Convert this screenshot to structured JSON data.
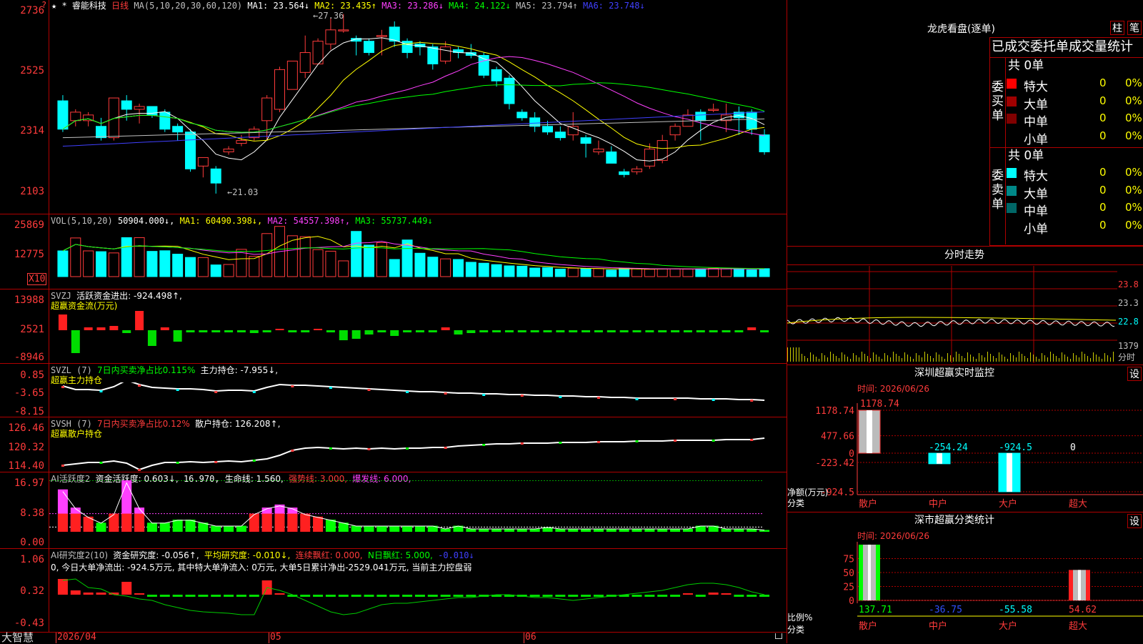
{
  "left_header": {
    "marks": "★ *",
    "stock_name": "睿能科技",
    "period": "日线",
    "ma_label": "MA(5,10,20,30,60,120)",
    "ma_items": [
      {
        "label": "MA1: 23.564↓",
        "color": "#ffffff"
      },
      {
        "label": "MA2: 23.435↑",
        "color": "#ffff00"
      },
      {
        "label": "MA3: 23.286↓",
        "color": "#ff40ff"
      },
      {
        "label": "MA4: 24.122↓",
        "color": "#00ff00"
      },
      {
        "label": "MA5: 23.794↑",
        "color": "#c0c0c0"
      },
      {
        "label": "MA6: 23.748↓",
        "color": "#4040ff"
      }
    ]
  },
  "price_panel": {
    "y_labels": [
      "2736",
      "2525",
      "2314",
      "2103"
    ],
    "high_marker": "27.36",
    "low_marker": "21.03"
  },
  "vol_panel": {
    "header": "VOL(5,10,20)",
    "vol_value": "50904.000↓,",
    "ma1": "MA1: 60490.398↓,",
    "ma2": "MA2: 54557.398↑,",
    "ma3": "MA3: 55737.449↓",
    "y_labels": [
      "25869",
      "12775"
    ],
    "unit_badge": "X10"
  },
  "svzj_panel": {
    "line1_a": "SVZJ",
    "line1_b": "活跃资金进出: -924.498↑,",
    "line2": "超赢资金流(万元)",
    "y_labels": [
      "13988",
      "2521",
      "-8946"
    ]
  },
  "svzl_panel": {
    "a": "SVZL (7)",
    "b": "7日内买卖净占比0.115%",
    "c": "主力持仓: -7.955↓,",
    "line2": "超赢主力持仓",
    "y_labels": [
      "0.85",
      "-3.65",
      "-8.15"
    ]
  },
  "svsh_panel": {
    "a": "SVSH (7)",
    "b": "7日内买卖净占比0.12%",
    "c": "散户持仓: 126.208↑,",
    "line2": "超赢散户持仓",
    "y_labels": [
      "126.46",
      "120.32",
      "114.40"
    ]
  },
  "ai_active_panel": {
    "a": "AI活跃度2",
    "b": "资金活跃度: 0.603↓,",
    "c": "16.970,",
    "d": "生命线: 1.560,",
    "e": "强势线: 3.000,",
    "f": "爆发线: 6.000,",
    "y_labels": [
      "16.97",
      "8.38",
      "0.00"
    ]
  },
  "ai_research_panel": {
    "a": "AI研究度2(10)",
    "b": "资金研究度: -0.056↑,",
    "c": "平均研究度: -0.010↓,",
    "d": "连续飘红: 0.000,",
    "e": "N日飘红: 5.000,",
    "f": "-0.010↓",
    "desc": "0, 今日大单净流出: -924.5万元, 其中特大单净流入: 0万元, 大单5日累计净出-2529.041万元, 当前主力控盘弱",
    "y_labels": [
      "1.06",
      "0.32",
      "-0.43"
    ]
  },
  "bottom_axis": {
    "brand": "大智慧",
    "dates": [
      "2026/04",
      "05",
      "06"
    ]
  },
  "dragon_tiger": {
    "title": "龙虎看盘(逐单)",
    "btn_a": "柱",
    "btn_b": "笔",
    "subtitle": "已成交委托单成交量统计",
    "buy_label": "委买单",
    "sell_label": "委卖单",
    "buy_total": "共 0单",
    "sell_total": "共 0单",
    "buy_rows": [
      {
        "name": "特大",
        "count": "0",
        "pct": "0%",
        "color": "#ff0000"
      },
      {
        "name": "大单",
        "count": "0",
        "pct": "0%",
        "color": "#a00000"
      },
      {
        "name": "中单",
        "count": "0",
        "pct": "0%",
        "color": "#800000"
      },
      {
        "name": "小单",
        "count": "0",
        "pct": "0%",
        "color": "#000000"
      }
    ],
    "sell_rows": [
      {
        "name": "特大",
        "count": "0",
        "pct": "0%",
        "color": "#00ffff"
      },
      {
        "name": "大单",
        "count": "0",
        "pct": "0%",
        "color": "#008888"
      },
      {
        "name": "中单",
        "count": "0",
        "pct": "0%",
        "color": "#006666"
      },
      {
        "name": "小单",
        "count": "0",
        "pct": "0%",
        "color": "#000000"
      }
    ]
  },
  "intraday": {
    "title": "分时走势",
    "y_labels": [
      "23.8",
      "23.3",
      "22.8"
    ],
    "vol_label": "1379",
    "vol_unit": "分时"
  },
  "sz_monitor": {
    "title": "深圳超赢实时监控",
    "settings": "设",
    "time": "时间: 2026/06/26",
    "y_labels": [
      "1178.74",
      "477.66",
      "0",
      "-223.42",
      "-924.5"
    ],
    "y_title": "净额(万元)",
    "x_title": "分类",
    "bar_values": [
      "1178.74",
      "-254.24",
      "-924.5",
      "0"
    ],
    "categories": [
      "散户",
      "中户",
      "大户",
      "超大"
    ]
  },
  "sz_class": {
    "title": "深市超赢分类统计",
    "settings": "设",
    "time": "时间: 2026/06/26",
    "y_labels": [
      "75",
      "50",
      "25",
      "0"
    ],
    "y_title": "比例%",
    "x_title": "分类",
    "bar_values": [
      "137.71",
      "-36.75",
      "-55.58",
      "54.62"
    ],
    "categories": [
      "散户",
      "中户",
      "大户",
      "超大"
    ]
  },
  "chart_data": [
    {
      "type": "candlestick",
      "title": "睿能科技 日线",
      "ylim": [
        21.03,
        27.36
      ],
      "x": [
        "2026/04",
        "05",
        "06"
      ],
      "series": [
        {
          "name": "MA1",
          "values": [
            23.564
          ]
        },
        {
          "name": "MA2",
          "values": [
            23.435
          ]
        },
        {
          "name": "MA3",
          "values": [
            23.286
          ]
        },
        {
          "name": "MA4",
          "values": [
            24.122
          ]
        },
        {
          "name": "MA5",
          "values": [
            23.794
          ]
        },
        {
          "name": "MA6",
          "values": [
            23.748
          ]
        }
      ],
      "candles": [
        [
          24.3,
          24.5,
          23.2,
          23.3
        ],
        [
          23.6,
          24.0,
          23.4,
          23.9
        ],
        [
          23.6,
          23.9,
          23.4,
          23.8
        ],
        [
          23.4,
          23.7,
          22.9,
          23.0
        ],
        [
          23.0,
          24.4,
          22.9,
          24.4
        ],
        [
          24.3,
          24.5,
          23.6,
          24.0
        ],
        [
          24.0,
          24.2,
          23.5,
          24.1
        ],
        [
          24.1,
          24.1,
          23.7,
          23.8
        ],
        [
          23.9,
          24.0,
          23.2,
          23.3
        ],
        [
          23.4,
          23.5,
          22.9,
          23.2
        ],
        [
          23.2,
          23.3,
          21.8,
          21.9
        ],
        [
          22.0,
          22.3,
          21.6,
          22.3
        ],
        [
          21.9,
          22.0,
          21.03,
          21.4
        ],
        [
          22.5,
          22.7,
          22.4,
          22.6
        ],
        [
          22.8,
          23.1,
          22.7,
          22.9
        ],
        [
          23.0,
          23.4,
          22.9,
          23.3
        ],
        [
          23.6,
          24.5,
          22.9,
          24.4
        ],
        [
          24.0,
          25.5,
          23.9,
          25.4
        ],
        [
          24.7,
          25.7,
          24.7,
          25.7
        ],
        [
          25.3,
          26.6,
          25.1,
          26.0
        ],
        [
          25.6,
          26.5,
          25.6,
          26.4
        ],
        [
          26.3,
          27.2,
          26.1,
          26.8
        ],
        [
          26.8,
          27.36,
          26.7,
          26.8
        ],
        [
          26.5,
          26.6,
          25.9,
          26.4
        ],
        [
          26.4,
          26.5,
          25.9,
          26.0
        ],
        [
          26.6,
          26.8,
          25.9,
          26.6
        ],
        [
          26.9,
          27.1,
          26.2,
          26.4
        ],
        [
          26.4,
          26.5,
          25.8,
          26.0
        ],
        [
          26.3,
          26.4,
          25.9,
          26.2
        ],
        [
          26.2,
          26.3,
          25.4,
          25.6
        ],
        [
          25.7,
          26.4,
          25.6,
          26.2
        ],
        [
          26.1,
          26.2,
          25.8,
          26.0
        ],
        [
          26.0,
          26.3,
          25.8,
          25.9
        ],
        [
          25.9,
          26.0,
          25.1,
          25.2
        ],
        [
          25.4,
          25.5,
          24.8,
          25.0
        ],
        [
          25.1,
          25.2,
          24.0,
          24.2
        ],
        [
          23.9,
          24.0,
          23.6,
          23.7
        ],
        [
          23.7,
          23.9,
          23.2,
          23.4
        ],
        [
          23.4,
          23.6,
          23.1,
          23.2
        ],
        [
          23.2,
          23.4,
          22.9,
          23.0
        ],
        [
          23.1,
          23.9,
          22.9,
          23.4
        ],
        [
          23.0,
          23.1,
          22.3,
          22.8
        ],
        [
          22.5,
          22.9,
          22.4,
          22.6
        ],
        [
          22.5,
          22.7,
          22.1,
          22.1
        ],
        [
          21.8,
          21.9,
          21.6,
          21.7
        ],
        [
          21.8,
          22.0,
          21.7,
          21.9
        ],
        [
          22.0,
          22.8,
          21.9,
          22.6
        ],
        [
          22.2,
          23.1,
          22.1,
          22.9
        ],
        [
          23.1,
          23.5,
          22.9,
          23.4
        ],
        [
          23.4,
          24.0,
          23.4,
          23.8
        ],
        [
          23.9,
          24.0,
          22.9,
          23.6
        ],
        [
          24.0,
          24.2,
          23.9,
          24.0
        ],
        [
          23.6,
          24.2,
          23.2,
          23.8
        ],
        [
          23.9,
          24.1,
          23.1,
          23.7
        ],
        [
          23.9,
          24.0,
          23.1,
          23.3
        ],
        [
          23.1,
          23.3,
          22.4,
          22.5
        ]
      ]
    },
    {
      "type": "bar",
      "title": "VOL(5,10,20)",
      "ylim": [
        0,
        25869
      ],
      "series": [
        {
          "name": "VOL",
          "values": [
            16500,
            24800,
            16500,
            16000,
            15200,
            25000,
            25000,
            16200,
            16600,
            14400,
            12300,
            12200,
            7500,
            7800,
            17500,
            13000,
            27600,
            32200,
            26200,
            25600,
            17300,
            16300,
            10100,
            29000,
            20200,
            21800,
            11000,
            23500,
            15000,
            12500,
            11400,
            11000,
            9200,
            8600,
            7700,
            6900,
            6700,
            5500,
            5800,
            4800,
            5400,
            5100,
            5100,
            4200,
            5400,
            5000,
            4700,
            5000,
            5000,
            4800,
            5000,
            5300,
            5100,
            5200,
            4300,
            5100
          ]
        }
      ]
    }
  ]
}
